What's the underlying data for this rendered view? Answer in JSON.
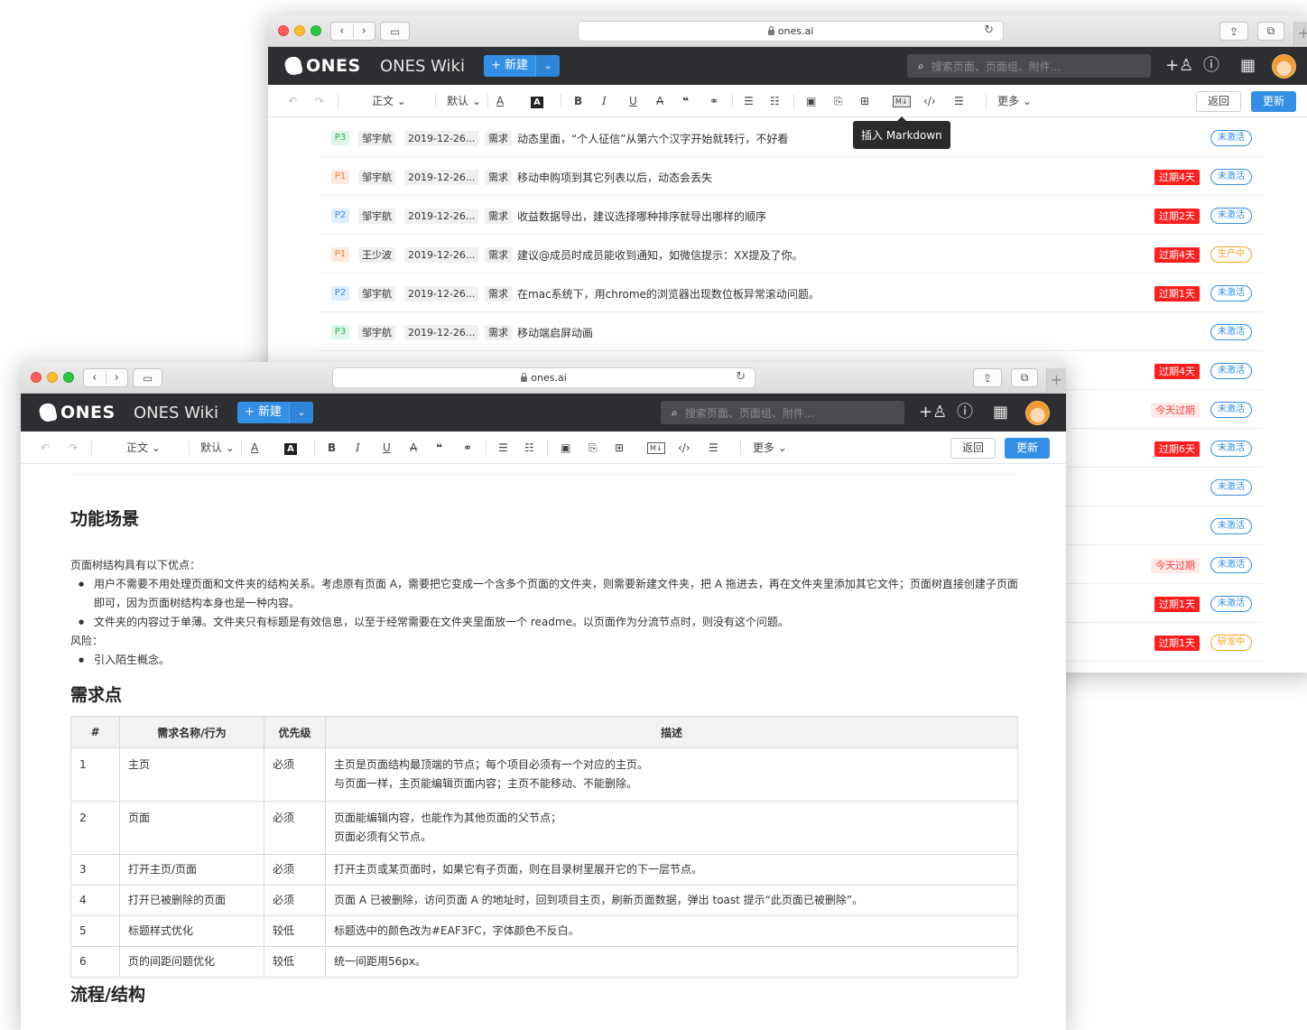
{
  "browser": {
    "url": "ones.ai"
  },
  "app": {
    "logo": "ONES",
    "title": "ONES Wiki",
    "new_button": "+ 新建",
    "search_placeholder": "搜索页面、页面组、附件..."
  },
  "toolbar": {
    "text_style": "正文 ⌄",
    "font": "默认 ⌄",
    "text_color": "A",
    "bg_color": "A",
    "bold": "B",
    "italic": "I",
    "underline": "U",
    "strike": "A",
    "quote": "❝",
    "link": "⚭",
    "bullets": "☰",
    "numbers": "☷",
    "image": "▣",
    "attach": "⎘",
    "table": "⊞",
    "markdown": "M↓",
    "code": "‹/›",
    "layout": "☰",
    "more": "更多 ⌄",
    "back": "返回",
    "update": "更新",
    "tooltip": "插入 Markdown"
  },
  "issues": [
    {
      "priority": "P3",
      "assignee": "邹宇航",
      "date": "2019-12-26...",
      "type": "需求",
      "title": "动态里面，“个人征信”从第六个汉字开始就转行，不好看",
      "overdue": "",
      "status": "未激活"
    },
    {
      "priority": "P1",
      "assignee": "邹宇航",
      "date": "2019-12-26...",
      "type": "需求",
      "title": "移动申购项到其它列表以后，动态会丢失",
      "overdue": "过期4天",
      "status": "未激活"
    },
    {
      "priority": "P2",
      "assignee": "邹宇航",
      "date": "2019-12-26...",
      "type": "需求",
      "title": "收益数据导出，建议选择哪种排序就导出哪样的顺序",
      "overdue": "过期2天",
      "status": "未激活"
    },
    {
      "priority": "P1",
      "assignee": "王少波",
      "date": "2019-12-26...",
      "type": "需求",
      "title": "建议@成员时成员能收到通知，如微信提示：XX提及了你。",
      "overdue": "过期4天",
      "status": "生产中"
    },
    {
      "priority": "P2",
      "assignee": "邹宇航",
      "date": "2019-12-26...",
      "type": "需求",
      "title": "在mac系统下，用chrome的浏览器出现数位板异常滚动问题。",
      "overdue": "过期1天",
      "status": "未激活"
    },
    {
      "priority": "P3",
      "assignee": "邹宇航",
      "date": "2019-12-26...",
      "type": "需求",
      "title": "移动端启屏动画",
      "overdue": "",
      "status": "未激活"
    },
    {
      "priority": "",
      "assignee": "",
      "date": "",
      "type": "",
      "title": "",
      "overdue": "过期4天",
      "status": "未激活"
    },
    {
      "priority": "",
      "assignee": "",
      "date": "",
      "type": "",
      "title": "",
      "overdue": "今天过期",
      "status": "未激活"
    },
    {
      "priority": "",
      "assignee": "",
      "date": "",
      "type": "",
      "title": "",
      "overdue": "过期6天",
      "status": "未激活"
    },
    {
      "priority": "",
      "assignee": "",
      "date": "",
      "type": "",
      "title": "",
      "overdue": "",
      "status": "未激活"
    },
    {
      "priority": "",
      "assignee": "",
      "date": "",
      "type": "",
      "title": "",
      "overdue": "",
      "status": "未激活"
    },
    {
      "priority": "",
      "assignee": "",
      "date": "",
      "type": "",
      "title": "",
      "overdue": "今天过期",
      "status": "未激活"
    },
    {
      "priority": "",
      "assignee": "",
      "date": "",
      "type": "",
      "title": "",
      "overdue": "过期1天",
      "status": "未激活"
    },
    {
      "priority": "",
      "assignee": "",
      "date": "",
      "type": "",
      "title": "",
      "overdue": "过期1天",
      "status": "研发中"
    }
  ],
  "doc": {
    "section1": "功能场景",
    "intro": "页面树结构具有以下优点：",
    "bullets1": [
      "用户不需要不用处理页面和文件夹的结构关系。考虑原有页面 A，需要把它变成一个含多个页面的文件夹，则需要新建文件夹，把 A 拖进去，再在文件夹里添加其它文件；页面树直接创建子页面即可，因为页面树结构本身也是一种内容。",
      "文件夹的内容过于单薄。文件夹只有标题是有效信息，以至于经常需要在文件夹里面放一个 readme。以页面作为分流节点时，则没有这个问题。"
    ],
    "risk_label": "风险：",
    "bullets2": [
      "引入陌生概念。"
    ],
    "section2": "需求点",
    "table_headers": [
      "#",
      "需求名称/行为",
      "优先级",
      "描述"
    ],
    "table_rows": [
      [
        "1",
        "主页",
        "必须",
        "主页是页面结构最顶端的节点；每个项目必须有一个对应的主页。\n与页面一样，主页能编辑页面内容；主页不能移动、不能删除。"
      ],
      [
        "2",
        "页面",
        "必须",
        "页面能编辑内容，也能作为其他页面的父节点；\n页面必须有父节点。"
      ],
      [
        "3",
        "打开主页/页面",
        "必须",
        "打开主页或某页面时，如果它有子页面，则在目录树里展开它的下一层节点。"
      ],
      [
        "4",
        "打开已被删除的页面",
        "必须",
        "页面 A 已被删除，访问页面 A 的地址时，回到项目主页，刷新页面数据，弹出 toast 提示“此页面已被删除”。"
      ],
      [
        "5",
        "标题样式优化",
        "较低",
        "标题选中的颜色改为#EAF3FC，字体颜色不反白。"
      ],
      [
        "6",
        "页的间距问题优化",
        "较低",
        "统一间距用56px。"
      ]
    ],
    "section3": "流程/结构"
  }
}
